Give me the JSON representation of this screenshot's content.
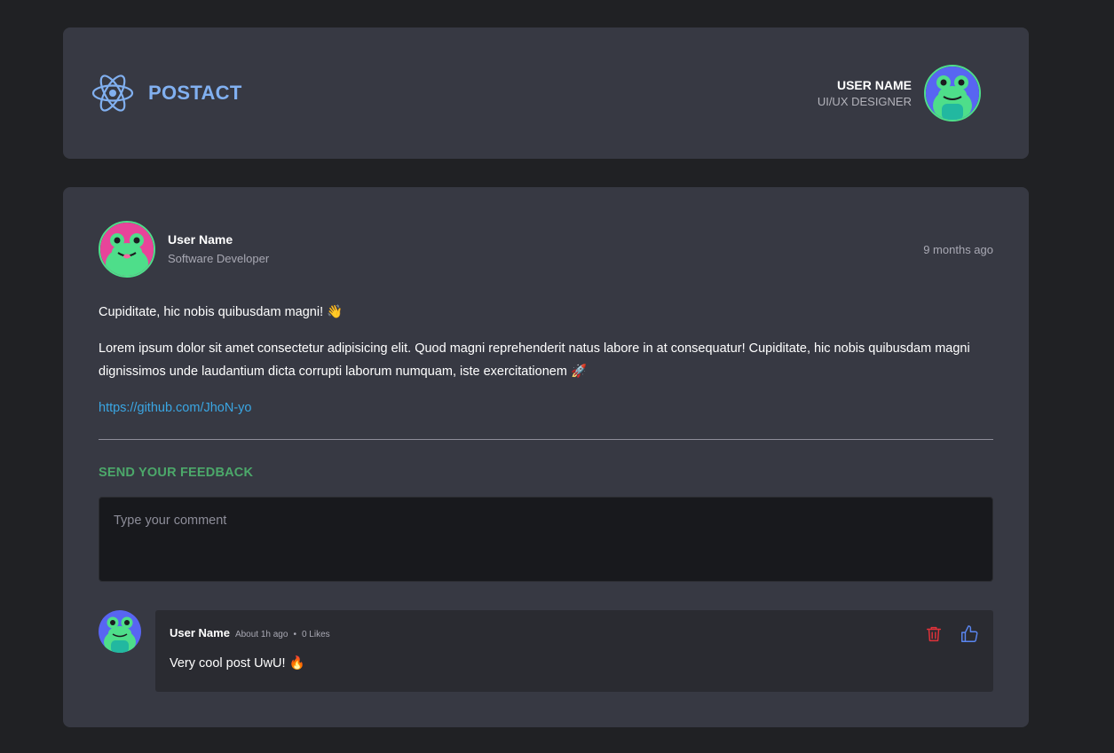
{
  "header": {
    "brand": "POSTACT",
    "brand_icon": "react-atom-icon",
    "user_name": "USER NAME",
    "user_role": "UI/UX DESIGNER",
    "accent_color": "#81b0f0"
  },
  "post": {
    "author_name": "User Name",
    "author_role": "Software Developer",
    "time": "9 months ago",
    "paragraph_1": "Cupiditate, hic nobis quibusdam magni!",
    "paragraph_1_emoji": "👋",
    "paragraph_2": "Lorem ipsum dolor sit amet consectetur adipisicing elit. Quod magni reprehenderit natus labore in at consequatur! Cupiditate, hic nobis quibusdam magni dignissimos unde laudantium dicta corrupti laborum numquam, iste exercitationem",
    "paragraph_2_emoji": "🚀",
    "link": "https://github.com/JhoN-yo"
  },
  "feedback": {
    "title": "SEND YOUR FEEDBACK",
    "placeholder": "Type your comment",
    "title_color": "#4ca86a"
  },
  "comments": [
    {
      "author": "User Name",
      "time": "About 1h ago",
      "separator": "•",
      "likes": "0 Likes",
      "text": "Very cool post UwU!",
      "emoji": "🔥",
      "delete_icon": "trash-icon",
      "like_icon": "thumbs-up-icon"
    }
  ]
}
